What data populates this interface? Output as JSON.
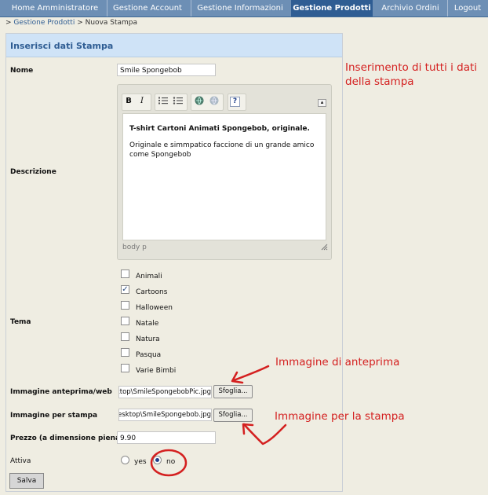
{
  "nav": {
    "items": [
      {
        "label": "Home Amministratore",
        "active": false
      },
      {
        "label": "Gestione Account",
        "active": false
      },
      {
        "label": "Gestione Informazioni",
        "active": false
      },
      {
        "label": "Gestione Prodotti",
        "active": true
      },
      {
        "label": "Archivio Ordini",
        "active": false
      },
      {
        "label": "Logout",
        "active": false
      }
    ]
  },
  "breadcrumb": {
    "prefix": ">",
    "link": "Gestione Prodotti",
    "separator": ">",
    "current": "Nuova Stampa"
  },
  "form": {
    "title": "Inserisci dati Stampa",
    "nome_label": "Nome",
    "nome_value": "Smile Spongebob",
    "descrizione_label": "Descrizione",
    "editor": {
      "bold_line": "T-shirt Cartoni Animati  Spongebob, originale.",
      "body_text": "Originale e simmpatico faccione di un grande amico come Spongebob",
      "status_path": "body   p",
      "toolbar_bold": "B",
      "toolbar_italic": "I",
      "toolbar_help": "?"
    },
    "tema_label": "Tema",
    "tema_options": [
      {
        "label": "Animali",
        "checked": false
      },
      {
        "label": "Cartoons",
        "checked": true
      },
      {
        "label": "Halloween",
        "checked": false
      },
      {
        "label": "Natale",
        "checked": false
      },
      {
        "label": "Natura",
        "checked": false
      },
      {
        "label": "Pasqua",
        "checked": false
      },
      {
        "label": "Varie Bimbi",
        "checked": false
      }
    ],
    "anteprima_label": "Immagine anteprima/web",
    "anteprima_value": "ktop\\SmileSpongebobPic.jpg",
    "stampa_label": "Immagine per stampa",
    "stampa_value": "esktop\\SmileSpongebob.jpg",
    "browse_label": "Sfoglia...",
    "prezzo_label": "Prezzo (a dimensione piena)",
    "prezzo_value": "9.90",
    "attiva_label": "Attiva",
    "attiva_yes": "yes",
    "attiva_no": "no",
    "attiva_selected": "no",
    "save_label": "Salva"
  },
  "annotations": {
    "note_inserimento": "Inserimento di tutti i dati della stampa",
    "note_anteprima": "Immagine di anteprima",
    "note_stampa": "Immagine per la stampa",
    "color": "#d42020"
  },
  "colors": {
    "nav_bg": "#6d8fb5",
    "nav_active": "#2f5d93",
    "header_bg": "#cfe3f7",
    "page_bg": "#efede2"
  }
}
